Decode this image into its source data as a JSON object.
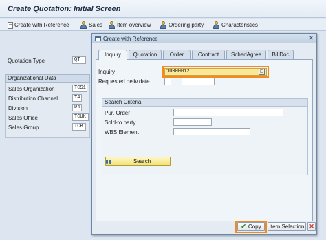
{
  "title": "Create Quotation: Initial Screen",
  "toolbar": {
    "create_with_reference": "Create with Reference",
    "sales": "Sales",
    "item_overview": "Item overview",
    "ordering_party": "Ordering party",
    "characteristics": "Characteristics"
  },
  "main": {
    "quotation_type_label": "Quotation Type",
    "quotation_type_value": "QT",
    "org_data_header": "Organizational Data",
    "org_fields": [
      {
        "label": "Sales Organization",
        "value": "TCS1"
      },
      {
        "label": "Distribution Channel",
        "value": "T4"
      },
      {
        "label": "Division",
        "value": "D4"
      },
      {
        "label": "Sales Office",
        "value": "TCUK"
      },
      {
        "label": "Sales Group",
        "value": "TCB"
      }
    ]
  },
  "dialog": {
    "title": "Create with Reference",
    "close_glyph": "✕",
    "tabs": [
      "Inquiry",
      "Quotation",
      "Order",
      "Contract",
      "SchedAgree",
      "BillDoc"
    ],
    "active_tab": "Inquiry",
    "inquiry_label": "Inquiry",
    "inquiry_value": "10000012",
    "requested_deliv_date_label": "Requested deliv.date",
    "search_criteria_header": "Search Criteria",
    "pur_order_label": "Pur. Order",
    "sold_to_party_label": "Sold-to party",
    "wbs_element_label": "WBS Element",
    "search_button": "Search",
    "copy_button": "Copy",
    "item_selection_button": "Item Selection",
    "cancel_glyph": "✕"
  },
  "colors": {
    "highlight_frame": "#f28a1d",
    "inquiry_field_bg": "#fbe79a"
  }
}
